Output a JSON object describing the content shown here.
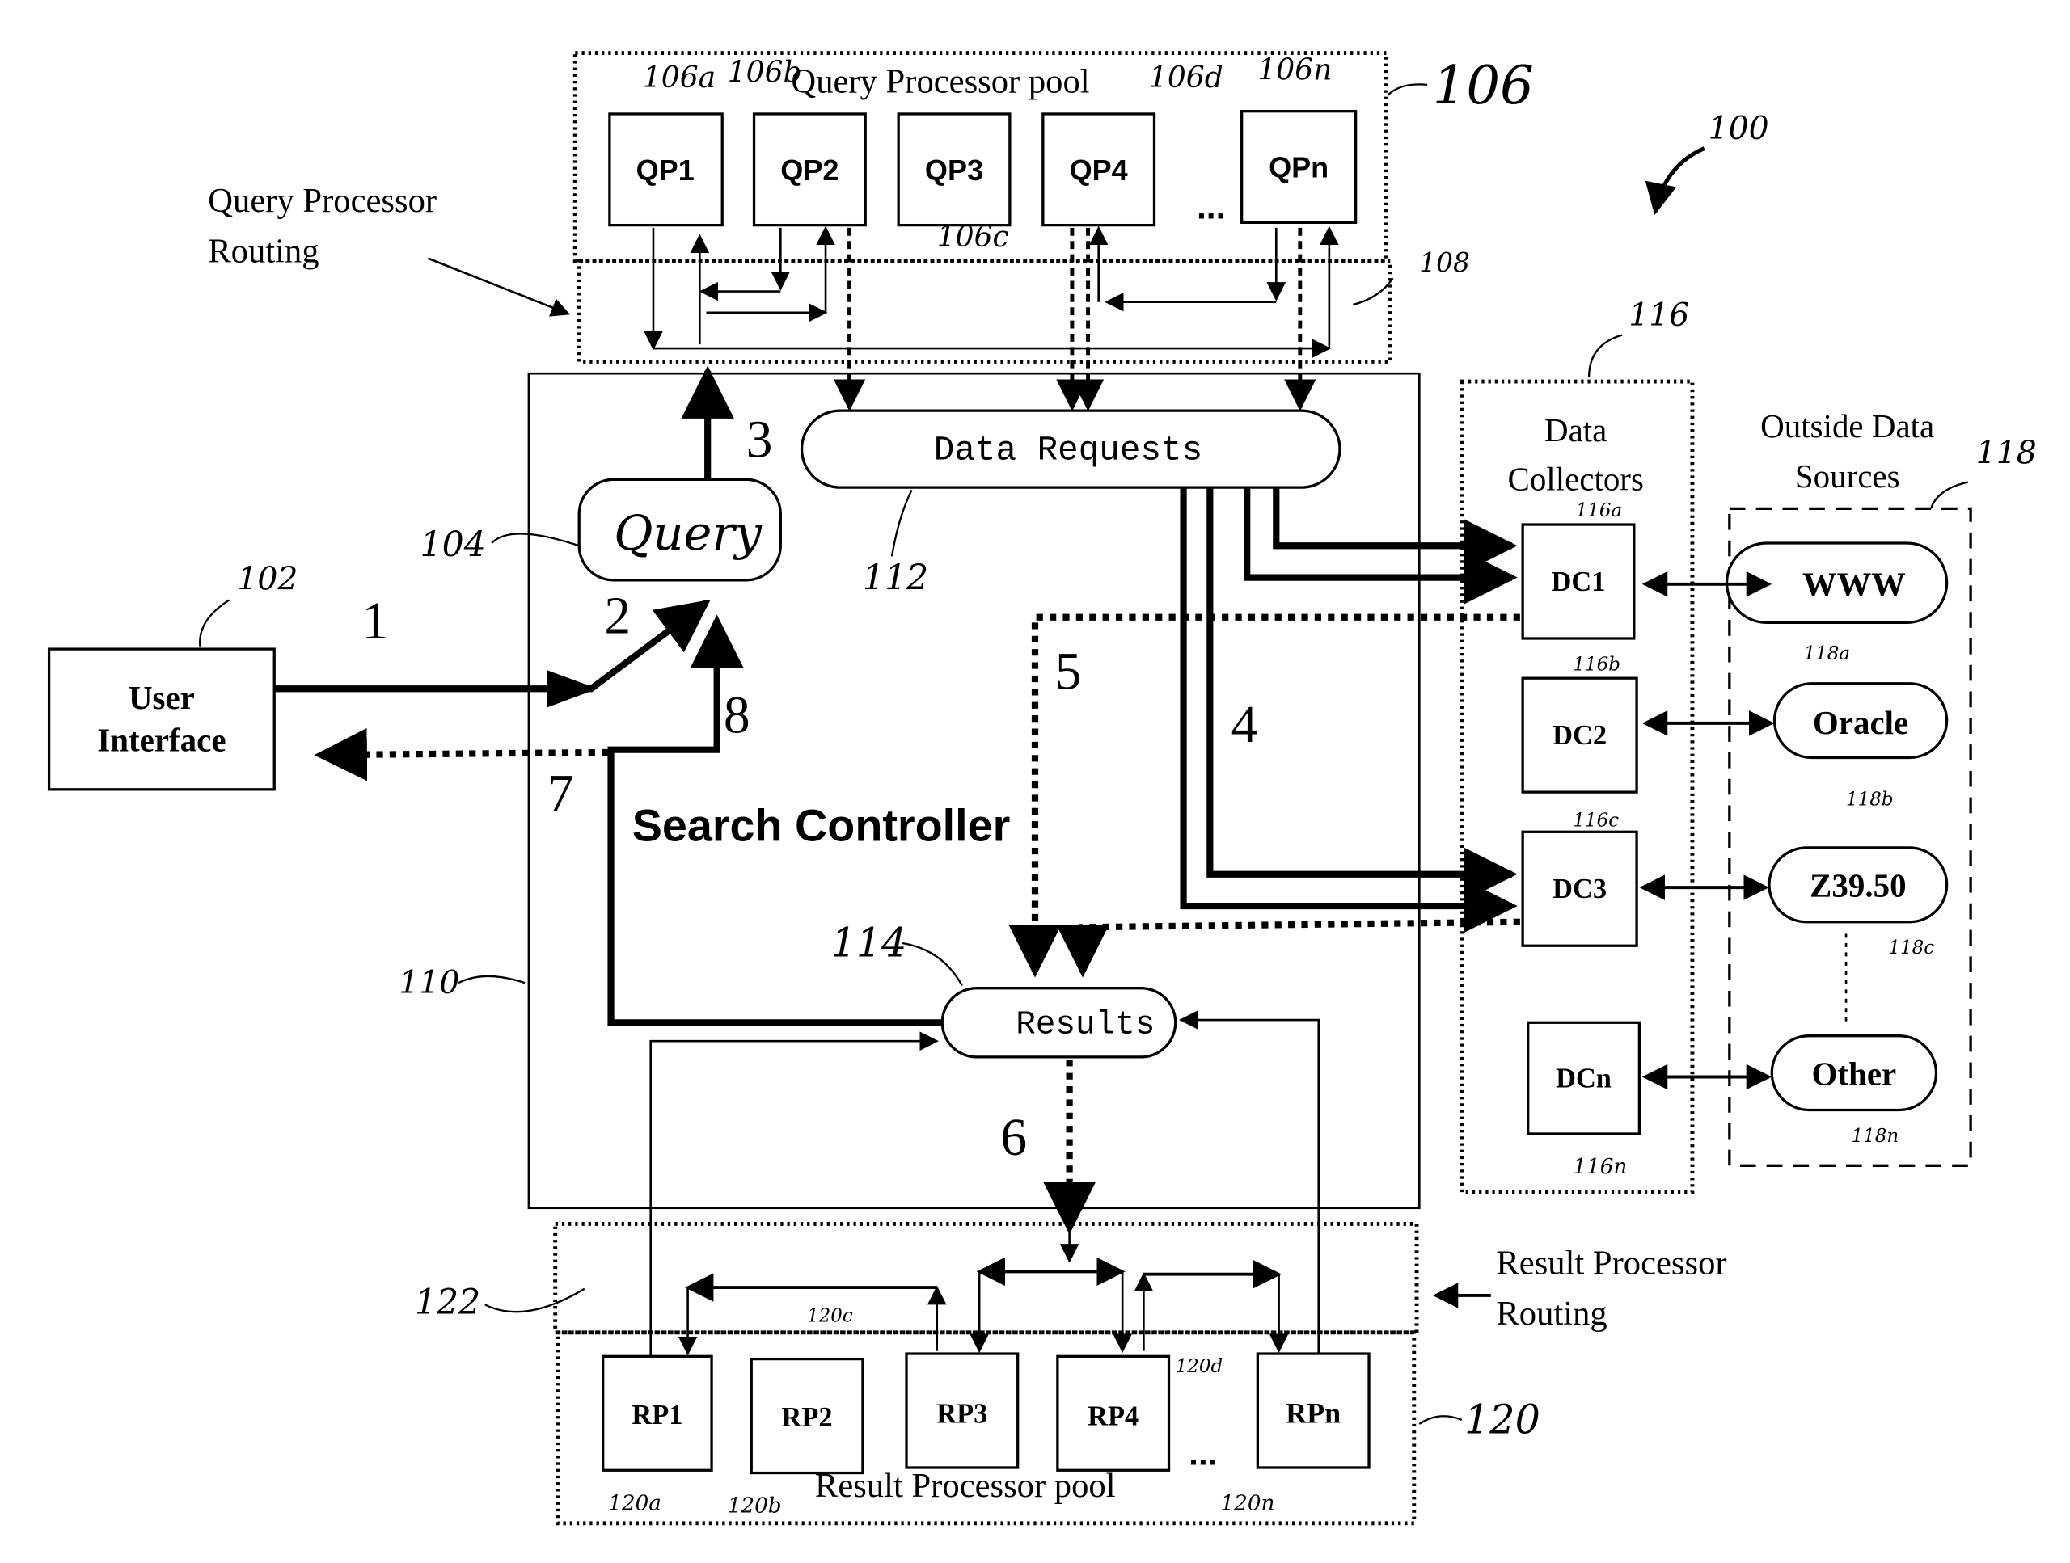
{
  "figure": {
    "figure_ref": "100",
    "query_pool": {
      "title": "Query Processor pool",
      "ref": "106",
      "routing_ref": "108",
      "routing_label_line1": "Query Processor",
      "routing_label_line2": "Routing",
      "processors": [
        {
          "label": "QP1",
          "ref": "106a"
        },
        {
          "label": "QP2",
          "ref": "106b"
        },
        {
          "label": "QP3",
          "ref": "106c"
        },
        {
          "label": "QP4",
          "ref": "106d"
        },
        {
          "label": "QPn",
          "ref": "106n"
        }
      ],
      "ellipsis": "..."
    },
    "search_controller": {
      "label": "Search Controller",
      "ref": "110"
    },
    "user_interface": {
      "line1": "User",
      "line2": "Interface",
      "ref": "102"
    },
    "query": {
      "label": "Query",
      "ref": "104"
    },
    "data_requests": {
      "label": "Data Requests",
      "ref": "112"
    },
    "results": {
      "label": "Results",
      "ref": "114"
    },
    "data_collectors": {
      "line1": "Data",
      "line2": "Collectors",
      "ref": "116",
      "items": [
        {
          "label": "DC1",
          "ref": "116a"
        },
        {
          "label": "DC2",
          "ref": "116b"
        },
        {
          "label": "DC3",
          "ref": "116c"
        },
        {
          "label": "DCn",
          "ref": "116n"
        }
      ]
    },
    "outside_sources": {
      "line1": "Outside Data",
      "line2": "Sources",
      "ref": "118",
      "items": [
        {
          "label": "WWW",
          "ref": "118a"
        },
        {
          "label": "Oracle",
          "ref": "118b"
        },
        {
          "label": "Z39.50",
          "ref": "118c"
        },
        {
          "label": "Other",
          "ref": "118n"
        }
      ]
    },
    "result_pool": {
      "title": "Result Processor pool",
      "ref": "120",
      "routing_ref": "122",
      "routing_label_line1": "Result Processor",
      "routing_label_line2": "Routing",
      "processors": [
        {
          "label": "RP1",
          "ref": "120a"
        },
        {
          "label": "RP2",
          "ref": "120b"
        },
        {
          "label": "RP3",
          "ref": "120c"
        },
        {
          "label": "RP4",
          "ref": "120d"
        },
        {
          "label": "RPn",
          "ref": "120n"
        }
      ],
      "ellipsis": "..."
    },
    "steps": [
      "1",
      "2",
      "3",
      "4",
      "5",
      "6",
      "7",
      "8"
    ]
  }
}
